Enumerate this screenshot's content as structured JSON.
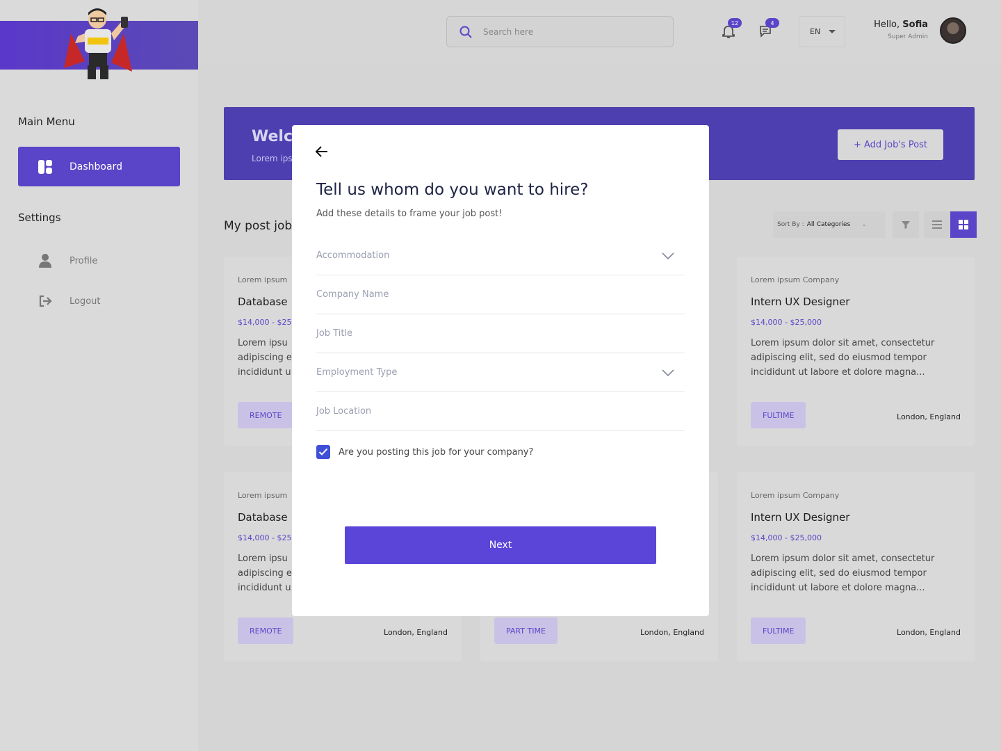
{
  "sidebar": {
    "main_menu_heading": "Main Menu",
    "settings_heading": "Settings",
    "dashboard_label": "Dashboard",
    "profile_label": "Profile",
    "logout_label": "Logout",
    "accent_color": "#5a45c8"
  },
  "header": {
    "search_placeholder": "Search here",
    "notifications_count": "12",
    "messages_count": "4",
    "language": "EN",
    "greeting": "Hello,",
    "user_name": "Sofia",
    "user_role": "Super Admin"
  },
  "banner": {
    "title": "Welc",
    "subtitle": "Lorem ips",
    "add_button": "+ Add Job's Post"
  },
  "posts": {
    "title": "My post job",
    "sort_label": "Sort By :",
    "sort_value": "All Categories"
  },
  "cards": [
    {
      "company": "Lorem ipsum",
      "role": "Database",
      "salary": "$14,000 - $25",
      "desc": "Lorem ipsu adipiscing e incididunt u",
      "tag": "REMOTE",
      "location": ""
    },
    {
      "company": "Lorem ipsum Company",
      "role": "Intern UX Designer",
      "salary": "$14,000 - $25,000",
      "desc": "Lorem ipsum dolor sit amet, consectetur adipiscing elit, sed do eiusmod tempor incididunt ut labore et dolore magna...",
      "tag": "FULTIME",
      "location": "London, England"
    },
    {
      "company": "Lorem ipsum",
      "role": "Database",
      "salary": "$14,000 - $25",
      "desc": "Lorem ipsu adipiscing e incididunt u",
      "tag": "REMOTE",
      "location": "London, England"
    },
    {
      "company": "",
      "role": "",
      "salary": "",
      "desc": "",
      "tag": "PART TIME",
      "location": "London, England"
    },
    {
      "company": "Lorem ipsum Company",
      "role": "Intern UX Designer",
      "salary": "$14,000 - $25,000",
      "desc": "Lorem ipsum dolor sit amet, consectetur adipiscing elit, sed do eiusmod tempor incididunt ut labore et dolore magna...",
      "tag": "FULTIME",
      "location": "London, England"
    }
  ],
  "modal": {
    "title": "Tell us whom do you want to hire?",
    "subtitle": "Add these details to frame your job post!",
    "fields": {
      "accommodation": "Accommodation",
      "company_name": "Company Name",
      "job_title": "Job Title",
      "employment_type": "Employment Type",
      "job_location": "Job Location"
    },
    "checkbox_label": "Are you posting this job for your company?",
    "checkbox_checked": true,
    "next_button": "Next"
  }
}
